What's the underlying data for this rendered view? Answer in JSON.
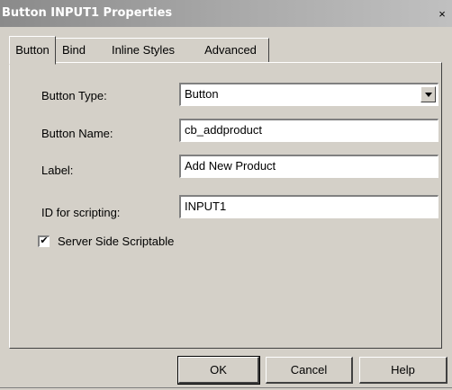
{
  "window": {
    "title": "Button INPUT1 Properties",
    "close_glyph": "×",
    "close_icon": "close-icon"
  },
  "tabs": [
    {
      "label": "Button",
      "active": true
    },
    {
      "label": "Bind",
      "active": false
    },
    {
      "label": "Inline Styles",
      "active": false
    },
    {
      "label": "Advanced",
      "active": false
    }
  ],
  "form": {
    "button_type": {
      "label": "Button Type:",
      "value": "Button"
    },
    "button_name": {
      "label": "Button Name:",
      "value": "cb_addproduct"
    },
    "label_field": {
      "label": "Label:",
      "value": "Add New Product"
    },
    "id_scripting": {
      "label": "ID for scripting:",
      "value": "INPUT1"
    },
    "server_side": {
      "label": "Server Side Scriptable",
      "checked": true,
      "check_glyph": "✔"
    }
  },
  "buttons": {
    "ok": "OK",
    "cancel": "Cancel",
    "help": "Help"
  },
  "colors": {
    "face": "#d4d0c8",
    "titlebar": "#a8a8a8",
    "field": "#ffffff"
  }
}
